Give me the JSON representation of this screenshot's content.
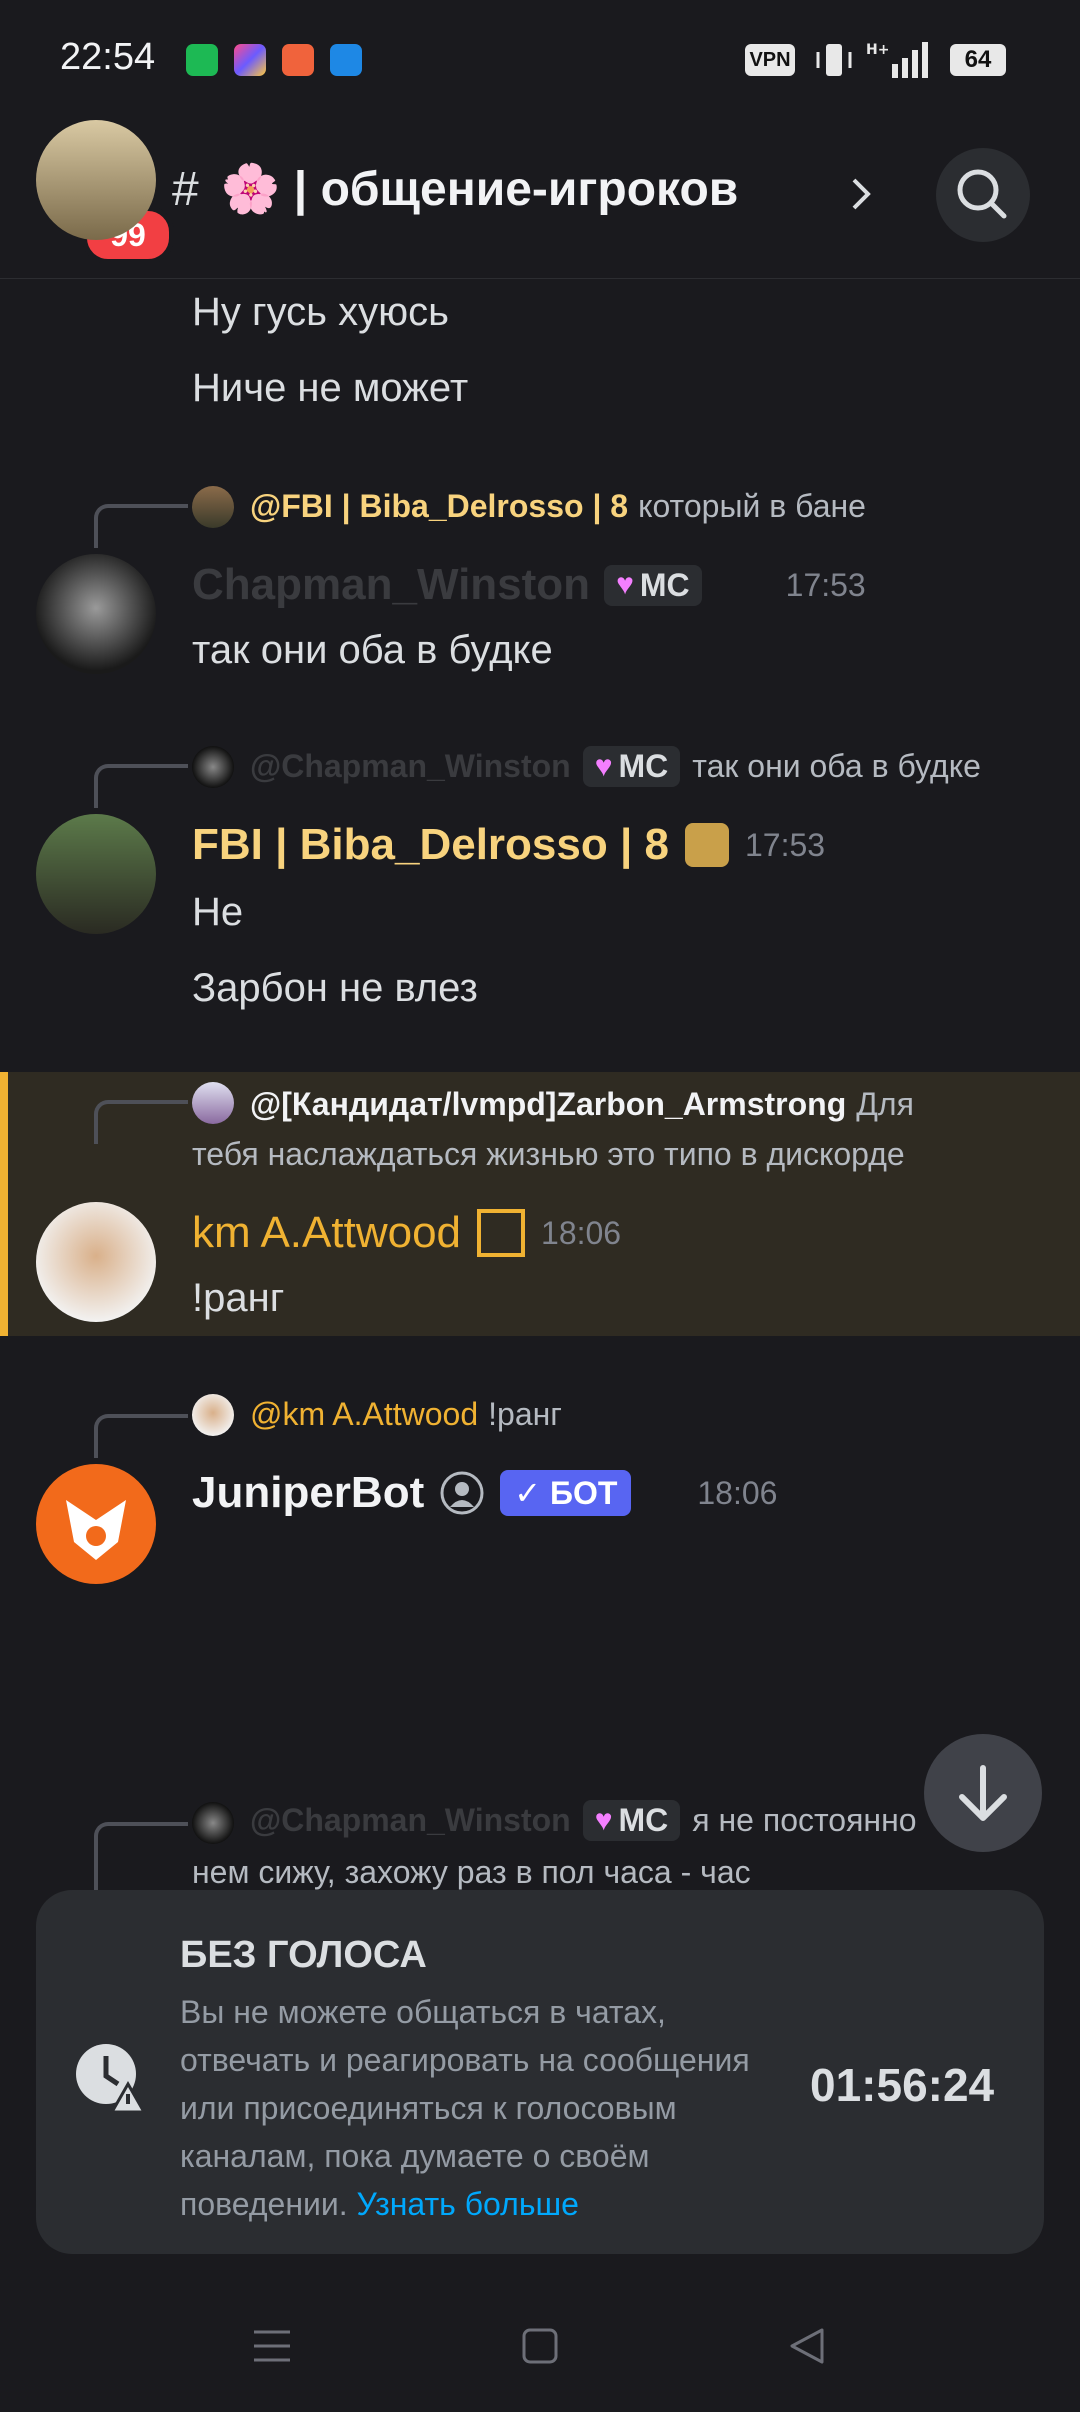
{
  "status_bar": {
    "time": "22:54",
    "vpn": "VPN",
    "battery": "64"
  },
  "header": {
    "unread_badge": "99",
    "channel_title": "🌸 | общение-игроков"
  },
  "messages": [
    {
      "lines": [
        "Ну гусь хуюсь",
        "Ниче не может"
      ]
    },
    {
      "reply": {
        "name": "@FBI | Biba_Delrosso | 8",
        "text": "который в бане"
      },
      "author": "Chapman_Winston",
      "tag": "MC",
      "time": "17:53",
      "lines": [
        "так они оба в будке"
      ]
    },
    {
      "reply": {
        "name": "@Chapman_Winston",
        "tag": "MC",
        "text": "так они оба в будке"
      },
      "author": "FBI | Biba_Delrosso | 8",
      "time": "17:53",
      "lines": [
        "Не",
        "Зарбон не влез"
      ]
    },
    {
      "reply": {
        "name": "@[Кандидат/lvmpd]Zarbon_Armstrong",
        "text": "Для",
        "text2": "тебя наслаждаться жизнью это типо в дискорде"
      },
      "author": "km A.Attwood",
      "time": "18:06",
      "lines": [
        "!ранг"
      ]
    },
    {
      "reply": {
        "name": "@km A.Attwood",
        "text": "!ранг"
      },
      "author": "JuniperBot",
      "bot_tag": "✓ БОТ",
      "time": "18:06"
    },
    {
      "reply": {
        "name": "@Chapman_Winston",
        "tag": "MC",
        "text": "я не постоянно",
        "text2": "нем сижу, захожу раз в пол часа - час"
      }
    }
  ],
  "timeout_panel": {
    "title": "БЕЗ ГОЛОСА",
    "body": "Вы не можете общаться в чатах, отвечать и реагировать на сообщения или присоединяться к голосовым каналам, пока думаете о своём поведении.",
    "link": "Узнать больше",
    "timer": "01:56:24"
  },
  "colors": {
    "accent_gold": "#f0b232",
    "mc_name": "#f8d37e",
    "bot_blue": "#5865f2",
    "link": "#00a8fc"
  }
}
